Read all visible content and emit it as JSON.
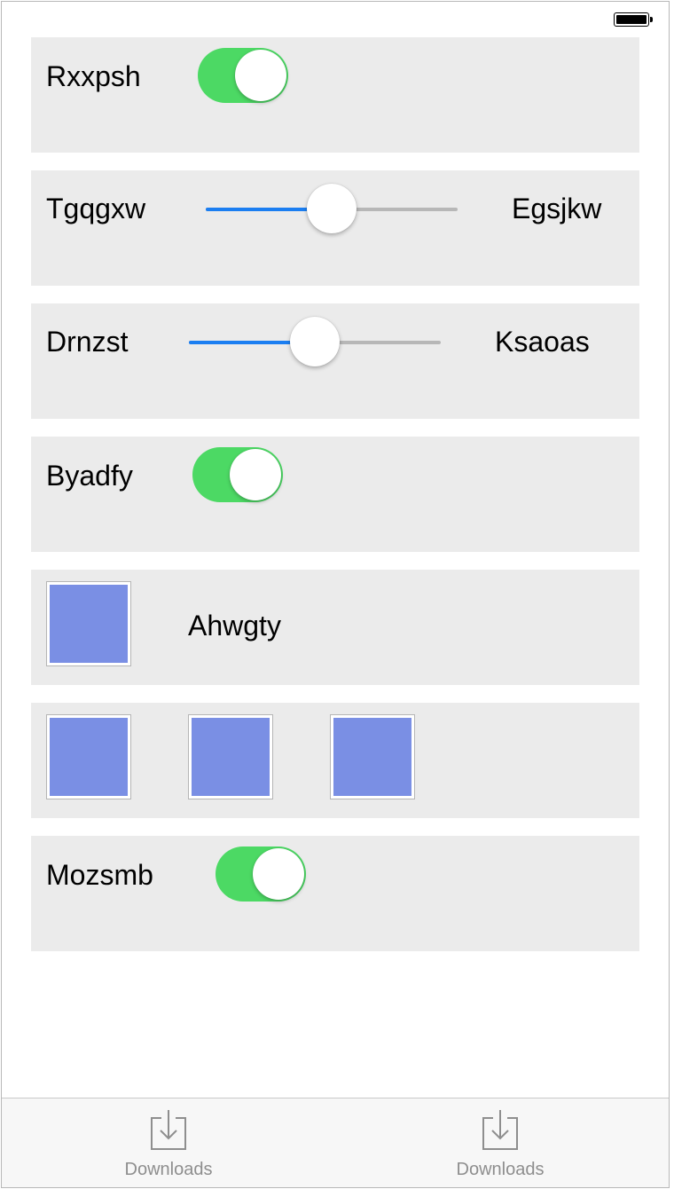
{
  "status_bar": {
    "battery_icon": "battery-full-icon"
  },
  "rows": [
    {
      "type": "switch",
      "label": "Rxxpsh",
      "on": true
    },
    {
      "type": "slider",
      "left_label": "Tgqgxw",
      "right_label": "Egsjkw",
      "value": 0.5
    },
    {
      "type": "slider",
      "left_label": "Drnzst",
      "right_label": "Ksaoas",
      "value": 0.5
    },
    {
      "type": "switch",
      "label": "Byadfy",
      "on": true
    },
    {
      "type": "image_label",
      "label": "Ahwgty"
    },
    {
      "type": "images",
      "count": 3
    },
    {
      "type": "switch",
      "label": "Mozsmb",
      "on": true
    }
  ],
  "tab_bar": {
    "items": [
      {
        "label": "Downloads",
        "icon": "download-icon"
      },
      {
        "label": "Downloads",
        "icon": "download-icon"
      }
    ]
  },
  "colors": {
    "row_bg": "#ebebeb",
    "switch_on": "#4cd964",
    "slider_fill": "#1b7ef1",
    "image_fill": "#7a8fe4"
  }
}
